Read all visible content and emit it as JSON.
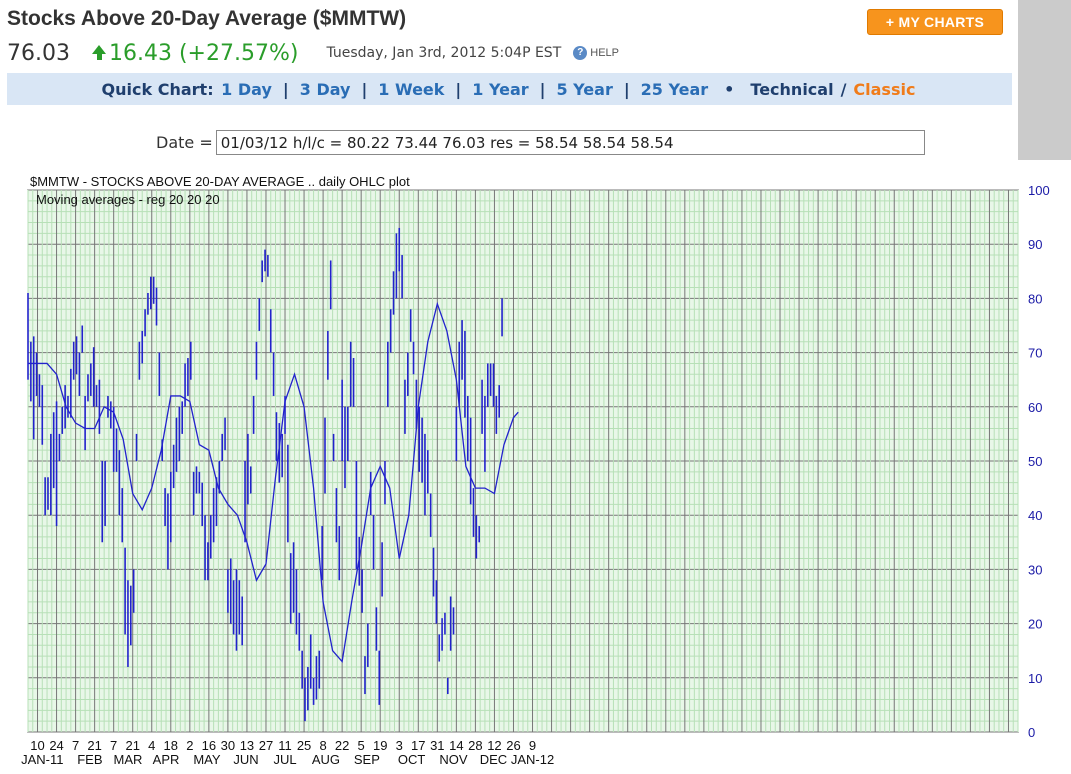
{
  "header": {
    "title": "Stocks Above 20-Day Average ($MMTW)",
    "my_charts_label": "+ MY CHARTS",
    "last": "76.03",
    "change": "16.43 (+27.57%)",
    "timestamp": "Tuesday, Jan 3rd, 2012 5:04P EST",
    "help_label": "HELP",
    "colors": {
      "up": "#2a9d2a",
      "accent": "#f7941d"
    }
  },
  "quick_chart": {
    "label": "Quick Chart:",
    "links": [
      "1 Day",
      "3 Day",
      "1 Week",
      "1 Year",
      "5 Year",
      "25 Year"
    ],
    "technical": "Technical",
    "classic": "Classic"
  },
  "date_row": {
    "label": "Date =",
    "value": "01/03/12 h/l/c = 80.22 73.44 76.03 res = 58.54 58.54 58.54"
  },
  "chart_data": {
    "type": "line",
    "title": "$MMTW - STOCKS ABOVE 20-DAY AVERAGE .. daily OHLC plot",
    "subtitle": "Moving averages - reg  20  20  20",
    "ylim": [
      0,
      100
    ],
    "yticks": [
      0,
      10,
      20,
      30,
      40,
      50,
      60,
      70,
      80,
      90,
      100
    ],
    "xlim": [
      0,
      104
    ],
    "x_day_labels": [
      {
        "x": 1,
        "label": "10"
      },
      {
        "x": 3,
        "label": "24"
      },
      {
        "x": 5,
        "label": "7"
      },
      {
        "x": 7,
        "label": "21"
      },
      {
        "x": 9,
        "label": "7"
      },
      {
        "x": 11,
        "label": "21"
      },
      {
        "x": 13,
        "label": "4"
      },
      {
        "x": 15,
        "label": "18"
      },
      {
        "x": 17,
        "label": "2"
      },
      {
        "x": 19,
        "label": "16"
      },
      {
        "x": 21,
        "label": "30"
      },
      {
        "x": 23,
        "label": "13"
      },
      {
        "x": 25,
        "label": "27"
      },
      {
        "x": 27,
        "label": "11"
      },
      {
        "x": 29,
        "label": "25"
      },
      {
        "x": 31,
        "label": "8"
      },
      {
        "x": 33,
        "label": "22"
      },
      {
        "x": 35,
        "label": "5"
      },
      {
        "x": 37,
        "label": "19"
      },
      {
        "x": 39,
        "label": "3"
      },
      {
        "x": 41,
        "label": "17"
      },
      {
        "x": 43,
        "label": "31"
      },
      {
        "x": 45,
        "label": "14"
      },
      {
        "x": 47,
        "label": "28"
      },
      {
        "x": 49,
        "label": "12"
      },
      {
        "x": 51,
        "label": "26"
      },
      {
        "x": 53,
        "label": "9"
      }
    ],
    "x_month_labels": [
      {
        "x": 1.5,
        "label": "JAN-11"
      },
      {
        "x": 6.5,
        "label": "FEB"
      },
      {
        "x": 10.5,
        "label": "MAR"
      },
      {
        "x": 14.5,
        "label": "APR"
      },
      {
        "x": 18.8,
        "label": "MAY"
      },
      {
        "x": 22.9,
        "label": "JUN"
      },
      {
        "x": 27.0,
        "label": "JUL"
      },
      {
        "x": 31.3,
        "label": "AUG"
      },
      {
        "x": 35.6,
        "label": "SEP"
      },
      {
        "x": 40.3,
        "label": "OCT"
      },
      {
        "x": 44.7,
        "label": "NOV"
      },
      {
        "x": 48.9,
        "label": "DEC"
      },
      {
        "x": 53,
        "label": "JAN-12"
      }
    ],
    "moving_average": {
      "name": "MA 20",
      "points": [
        [
          0,
          68
        ],
        [
          1,
          68
        ],
        [
          2,
          68
        ],
        [
          3,
          66
        ],
        [
          4,
          60
        ],
        [
          5,
          57
        ],
        [
          6,
          56
        ],
        [
          7,
          56
        ],
        [
          8,
          60
        ],
        [
          9,
          59
        ],
        [
          10,
          54
        ],
        [
          11,
          44
        ],
        [
          12,
          41
        ],
        [
          13,
          45
        ],
        [
          14,
          52
        ],
        [
          15,
          62
        ],
        [
          16,
          62
        ],
        [
          17,
          61
        ],
        [
          18,
          53
        ],
        [
          19,
          52
        ],
        [
          20,
          45
        ],
        [
          21,
          42
        ],
        [
          22,
          40
        ],
        [
          23,
          35
        ],
        [
          24,
          28
        ],
        [
          25,
          31
        ],
        [
          26,
          47
        ],
        [
          27,
          61
        ],
        [
          28,
          66
        ],
        [
          29,
          60
        ],
        [
          30,
          45
        ],
        [
          31,
          24
        ],
        [
          32,
          15
        ],
        [
          33,
          13
        ],
        [
          34,
          24
        ],
        [
          35,
          34
        ],
        [
          36,
          45
        ],
        [
          37,
          49
        ],
        [
          38,
          45
        ],
        [
          39,
          32
        ],
        [
          40,
          40
        ],
        [
          41,
          60
        ],
        [
          42,
          72
        ],
        [
          43,
          79
        ],
        [
          44,
          74
        ],
        [
          45,
          65
        ],
        [
          46,
          49
        ],
        [
          47,
          45
        ],
        [
          48,
          45
        ],
        [
          49,
          44
        ],
        [
          50,
          53
        ],
        [
          51,
          58
        ],
        [
          51.5,
          59
        ]
      ]
    },
    "bars": [
      [
        0,
        81,
        65
      ],
      [
        0.3,
        72,
        61
      ],
      [
        0.6,
        73,
        54
      ],
      [
        0.9,
        70,
        62
      ],
      [
        1.2,
        66,
        60
      ],
      [
        1.5,
        64,
        53
      ],
      [
        1.8,
        47,
        40
      ],
      [
        2.1,
        47,
        41
      ],
      [
        2.4,
        55,
        40
      ],
      [
        2.7,
        59,
        45
      ],
      [
        3.0,
        61,
        38
      ],
      [
        3.3,
        55,
        50
      ],
      [
        3.6,
        60,
        55
      ],
      [
        3.9,
        64,
        56
      ],
      [
        4.2,
        62,
        58
      ],
      [
        4.5,
        67,
        58
      ],
      [
        4.8,
        72,
        65
      ],
      [
        5.1,
        73,
        66
      ],
      [
        5.4,
        70,
        62
      ],
      [
        5.7,
        75,
        70
      ],
      [
        6.0,
        62,
        52
      ],
      [
        6.3,
        66,
        61
      ],
      [
        6.6,
        68,
        62
      ],
      [
        6.9,
        71,
        60
      ],
      [
        7.2,
        64,
        60
      ],
      [
        7.5,
        65,
        55
      ],
      [
        7.8,
        50,
        35
      ],
      [
        8.1,
        50,
        38
      ],
      [
        8.4,
        62,
        58
      ],
      [
        8.7,
        61,
        56
      ],
      [
        9.0,
        60,
        48
      ],
      [
        9.3,
        56,
        48
      ],
      [
        9.6,
        52,
        40
      ],
      [
        9.9,
        45,
        35
      ],
      [
        10.2,
        34,
        18
      ],
      [
        10.5,
        28,
        12
      ],
      [
        10.8,
        27,
        16
      ],
      [
        11.1,
        30,
        22
      ],
      [
        11.4,
        55,
        50
      ],
      [
        11.7,
        72,
        65
      ],
      [
        12.0,
        74,
        68
      ],
      [
        12.3,
        78,
        73
      ],
      [
        12.6,
        81,
        77
      ],
      [
        12.9,
        84,
        78
      ],
      [
        13.2,
        84,
        79
      ],
      [
        13.5,
        82,
        75
      ],
      [
        13.8,
        70,
        62
      ],
      [
        14.1,
        54,
        50
      ],
      [
        14.4,
        45,
        38
      ],
      [
        14.7,
        44,
        30
      ],
      [
        15.0,
        48,
        35
      ],
      [
        15.3,
        53,
        45
      ],
      [
        15.6,
        58,
        48
      ],
      [
        15.9,
        60,
        50
      ],
      [
        16.2,
        61,
        55
      ],
      [
        16.5,
        68,
        60
      ],
      [
        16.8,
        69,
        62
      ],
      [
        17.1,
        72,
        65
      ],
      [
        17.4,
        48,
        40
      ],
      [
        17.7,
        49,
        44
      ],
      [
        18.0,
        48,
        44
      ],
      [
        18.3,
        46,
        38
      ],
      [
        18.6,
        40,
        28
      ],
      [
        18.9,
        35,
        28
      ],
      [
        19.2,
        40,
        32
      ],
      [
        19.5,
        45,
        35
      ],
      [
        19.8,
        47,
        38
      ],
      [
        20.1,
        50,
        44
      ],
      [
        20.4,
        55,
        50
      ],
      [
        20.7,
        58,
        52
      ],
      [
        21.0,
        30,
        22
      ],
      [
        21.3,
        32,
        20
      ],
      [
        21.6,
        28,
        18
      ],
      [
        21.9,
        30,
        15
      ],
      [
        22.2,
        28,
        18
      ],
      [
        22.5,
        25,
        16
      ],
      [
        22.8,
        50,
        35
      ],
      [
        23.1,
        55,
        42
      ],
      [
        23.4,
        49,
        44
      ],
      [
        23.7,
        62,
        55
      ],
      [
        24.0,
        72,
        65
      ],
      [
        24.3,
        80,
        74
      ],
      [
        24.6,
        87,
        83
      ],
      [
        24.9,
        89,
        85
      ],
      [
        25.2,
        88,
        84
      ],
      [
        25.5,
        78,
        70
      ],
      [
        25.8,
        70,
        62
      ],
      [
        26.1,
        59,
        50
      ],
      [
        26.4,
        57,
        46
      ],
      [
        26.7,
        55,
        47
      ],
      [
        27.0,
        62,
        55
      ],
      [
        27.3,
        53,
        35
      ],
      [
        27.6,
        33,
        20
      ],
      [
        27.9,
        35,
        22
      ],
      [
        28.2,
        30,
        18
      ],
      [
        28.5,
        22,
        15
      ],
      [
        28.8,
        15,
        8
      ],
      [
        29.1,
        10,
        2
      ],
      [
        29.4,
        12,
        4
      ],
      [
        29.7,
        18,
        8
      ],
      [
        30.0,
        10,
        5
      ],
      [
        30.3,
        14,
        6
      ],
      [
        30.6,
        15,
        8
      ],
      [
        30.9,
        38,
        28
      ],
      [
        31.2,
        58,
        44
      ],
      [
        31.5,
        74,
        65
      ],
      [
        31.8,
        87,
        78
      ],
      [
        32.1,
        55,
        50
      ],
      [
        32.4,
        45,
        35
      ],
      [
        32.7,
        38,
        28
      ],
      [
        33.0,
        65,
        50
      ],
      [
        33.3,
        60,
        45
      ],
      [
        33.6,
        60,
        50
      ],
      [
        33.9,
        72,
        60
      ],
      [
        34.2,
        69,
        60
      ],
      [
        34.5,
        50,
        30
      ],
      [
        34.8,
        36,
        27
      ],
      [
        35.1,
        30,
        22
      ],
      [
        35.4,
        14,
        7
      ],
      [
        35.7,
        20,
        12
      ],
      [
        36.0,
        48,
        40
      ],
      [
        36.3,
        40,
        30
      ],
      [
        36.6,
        23,
        15
      ],
      [
        36.9,
        15,
        5
      ],
      [
        37.2,
        35,
        25
      ],
      [
        37.5,
        50,
        42
      ],
      [
        37.8,
        72,
        60
      ],
      [
        38.1,
        78,
        70
      ],
      [
        38.4,
        85,
        77
      ],
      [
        38.7,
        92,
        80
      ],
      [
        39.0,
        93,
        85
      ],
      [
        39.3,
        88,
        80
      ],
      [
        39.6,
        65,
        55
      ],
      [
        39.9,
        70,
        62
      ],
      [
        40.2,
        78,
        72
      ],
      [
        40.5,
        72,
        66
      ],
      [
        40.8,
        65,
        56
      ],
      [
        41.1,
        60,
        48
      ],
      [
        41.4,
        58,
        46
      ],
      [
        41.7,
        55,
        40
      ],
      [
        42.0,
        52,
        44
      ],
      [
        42.3,
        44,
        36
      ],
      [
        42.6,
        34,
        25
      ],
      [
        42.9,
        28,
        20
      ],
      [
        43.2,
        18,
        13
      ],
      [
        43.5,
        21,
        15
      ],
      [
        43.8,
        22,
        18
      ],
      [
        44.1,
        10,
        7
      ],
      [
        44.4,
        25,
        15
      ],
      [
        44.7,
        23,
        18
      ],
      [
        45.0,
        60,
        50
      ],
      [
        45.3,
        72,
        60
      ],
      [
        45.6,
        76,
        65
      ],
      [
        45.9,
        74,
        58
      ],
      [
        46.2,
        62,
        50
      ],
      [
        46.5,
        58,
        42
      ],
      [
        46.8,
        45,
        36
      ],
      [
        47.1,
        40,
        32
      ],
      [
        47.4,
        38,
        35
      ],
      [
        47.7,
        65,
        55
      ],
      [
        48.0,
        62,
        48
      ],
      [
        48.3,
        68,
        60
      ],
      [
        48.6,
        68,
        62
      ],
      [
        48.9,
        68,
        60
      ],
      [
        49.2,
        62,
        55
      ],
      [
        49.5,
        64,
        58
      ],
      [
        49.8,
        80,
        73
      ]
    ]
  }
}
